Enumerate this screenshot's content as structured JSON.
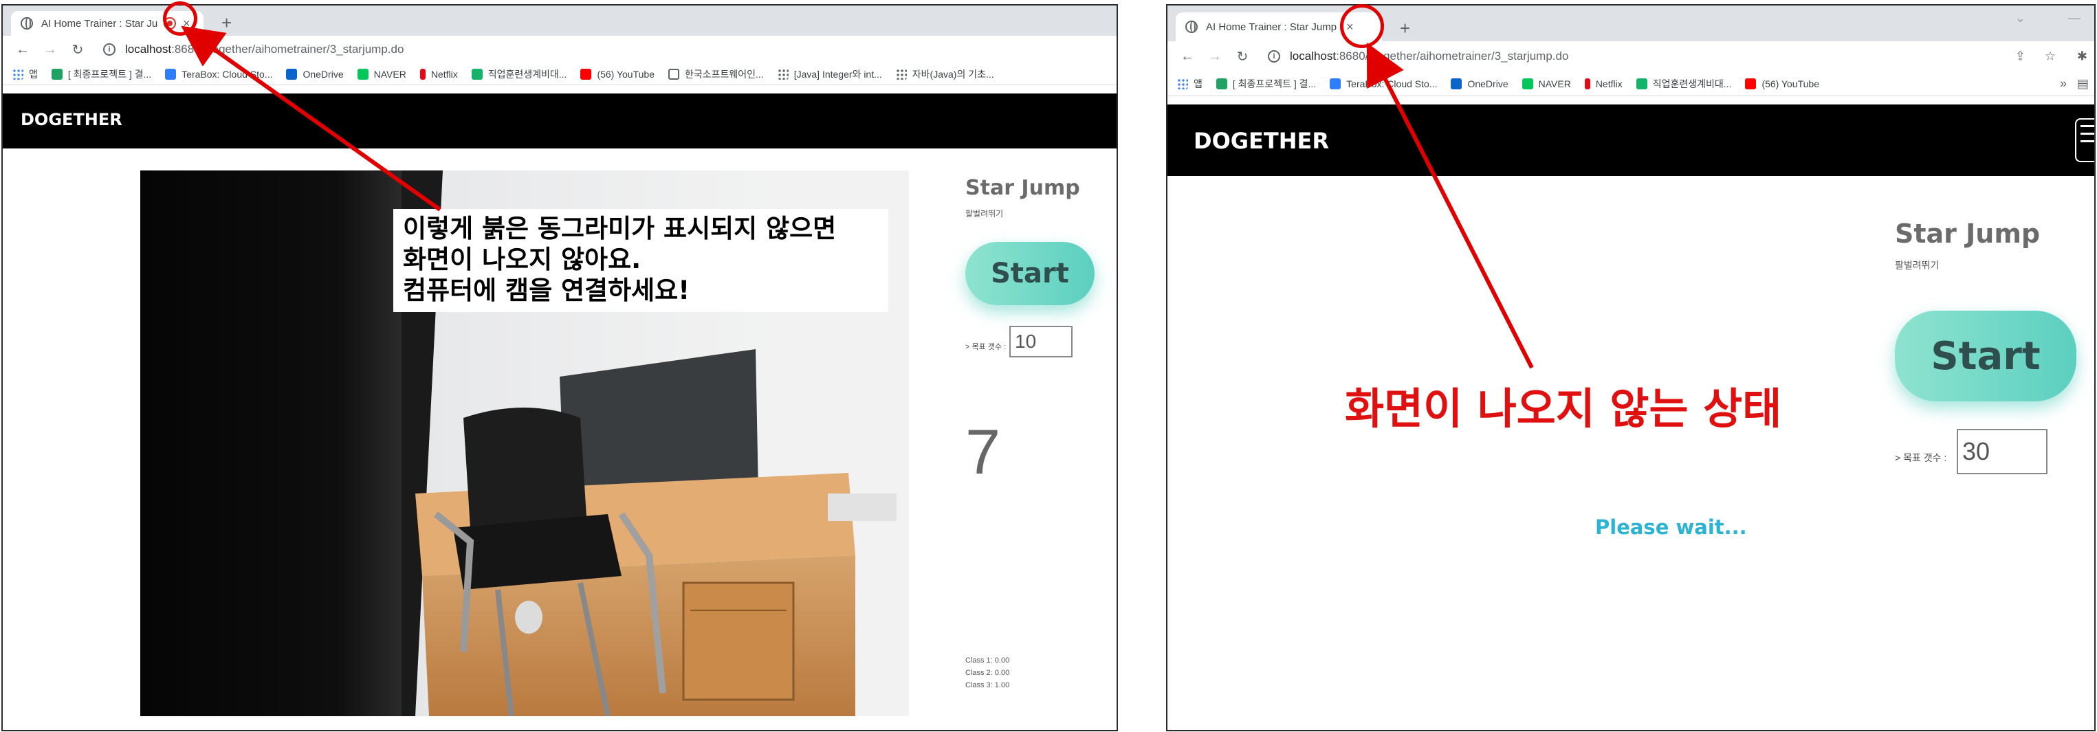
{
  "left": {
    "tab": {
      "title": "AI Home Trainer : Star Jump",
      "close": "×"
    },
    "new_tab": "+",
    "address": {
      "host": "localhost",
      "path": ":8680/Dogether/aihometrainer/3_starjump.do"
    },
    "bookmarks": [
      {
        "label": "앱",
        "icon": "apps-icon"
      },
      {
        "label": "[ 최종프로젝트 ] 결...",
        "icon": "green-square-icon"
      },
      {
        "label": "TeraBox: Cloud Sto...",
        "icon": "terabox-icon"
      },
      {
        "label": "OneDrive",
        "icon": "onedrive-icon"
      },
      {
        "label": "NAVER",
        "icon": "naver-icon"
      },
      {
        "label": "Netflix",
        "icon": "netflix-icon"
      },
      {
        "label": "직업훈련생계비대...",
        "icon": "job-icon"
      },
      {
        "label": "(56) YouTube",
        "icon": "youtube-icon"
      },
      {
        "label": "한국소프트웨어인...",
        "icon": "globe-icon"
      },
      {
        "label": "[Java] Integer와 int...",
        "icon": "dots-icon"
      },
      {
        "label": "자바(Java)의 기초...",
        "icon": "dots-icon"
      }
    ],
    "brand": "DOGETHER",
    "exercise": {
      "title": "Star Jump",
      "subtitle": "팔벌려뛰기"
    },
    "start_label": "Start",
    "goal_label": "> 목표 갯수 :",
    "goal_value": "10",
    "count": "7",
    "classes": [
      "Class 1: 0.00",
      "Class 2: 0.00",
      "Class 3: 1.00"
    ],
    "annotation": [
      "이렇게 붉은 동그라미가 표시되지 않으면",
      "화면이 나오지 않아요.",
      "컴퓨터에 캠을 연결하세요!"
    ]
  },
  "right": {
    "tab": {
      "title": "AI Home Trainer : Star Jump",
      "close": "×"
    },
    "new_tab": "+",
    "address": {
      "host": "localhost",
      "path": ":8680/Dogether/aihometrainer/3_starjump.do"
    },
    "bookmarks": [
      {
        "label": "앱",
        "icon": "apps-icon"
      },
      {
        "label": "[ 최종프로젝트 ] 결...",
        "icon": "green-square-icon"
      },
      {
        "label": "TeraBox: Cloud Sto...",
        "icon": "terabox-icon"
      },
      {
        "label": "OneDrive",
        "icon": "onedrive-icon"
      },
      {
        "label": "NAVER",
        "icon": "naver-icon"
      },
      {
        "label": "Netflix",
        "icon": "netflix-icon"
      },
      {
        "label": "직업훈련생계비대...",
        "icon": "job-icon"
      },
      {
        "label": "(56) YouTube",
        "icon": "youtube-icon"
      }
    ],
    "brand": "DOGETHER",
    "exercise": {
      "title": "Star Jump",
      "subtitle": "팔벌려뛰기"
    },
    "start_label": "Start",
    "goal_label": "> 목표 갯수 :",
    "goal_value": "30",
    "wait_text": "Please wait...",
    "annotation": "화면이 나오지 않는 상태"
  },
  "colors": {
    "annotation_red": "#e00000",
    "start_teal": "#5ccfc0",
    "wait_blue": "#2bb3d3",
    "nav_black": "#000000"
  }
}
